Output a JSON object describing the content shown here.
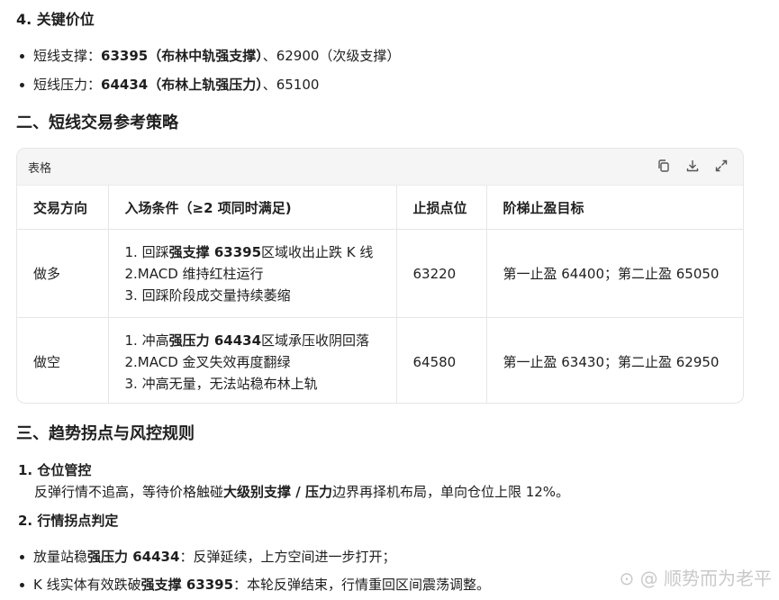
{
  "section4": {
    "heading": "4. 关键价位"
  },
  "levels": [
    {
      "label": "短线支撑：",
      "strong": "63395（布林中轨强支撑）",
      "rest": "、62900（次级支撑）"
    },
    {
      "label": "短线压力：",
      "strong": "64434（布林上轨强压力）",
      "rest": "、65100"
    }
  ],
  "section2": {
    "heading": "二、短线交易参考策略"
  },
  "table": {
    "caption": "表格",
    "toolbar": {
      "copy_icon": "copy-icon",
      "download_icon": "download-icon",
      "expand_icon": "expand-icon"
    },
    "headers": [
      "交易方向",
      "入场条件（≥2 项同时满足)",
      "止损点位",
      "阶梯止盈目标"
    ],
    "rows": [
      {
        "direction": "做多",
        "cond1_pre": "1. 回踩",
        "cond1_strong": "强支撑 63395",
        "cond1_post": "区域收出止跌 K 线",
        "cond2": "2.MACD 维持红柱运行",
        "cond3": "3. 回踩阶段成交量持续萎缩",
        "stop": "63220",
        "target": "第一止盈 64400；第二止盈 65050"
      },
      {
        "direction": "做空",
        "cond1_pre": "1. 冲高",
        "cond1_strong": "强压力 64434",
        "cond1_post": "区域承压收阴回落",
        "cond2": "2.MACD 金叉失效再度翻绿",
        "cond3": "3. 冲高无量，无法站稳布林上轨",
        "stop": "64580",
        "target": "第一止盈 63430；第二止盈 62950"
      }
    ]
  },
  "section3": {
    "heading": "三、趋势拐点与风控规则"
  },
  "rules": {
    "item1_title": "1. 仓位管控",
    "item1_pre": "反弹行情不追高，等待价格触碰",
    "item1_strong": "大级别支撑 / 压力",
    "item1_post": "边界再择机布局，单向仓位上限 12%。",
    "item2_title": "2. 行情拐点判定"
  },
  "turning": [
    {
      "pre": "放量站稳",
      "strong": "强压力 64434",
      "post": "：反弹延续，上方空间进一步打开；"
    },
    {
      "pre": "K 线实体有效跌破",
      "strong": "强支撑 63395",
      "post": "：本轮反弹结束，行情重回区间震荡调整。"
    }
  ],
  "watermark": "⊙ @ 顺势而为老平"
}
